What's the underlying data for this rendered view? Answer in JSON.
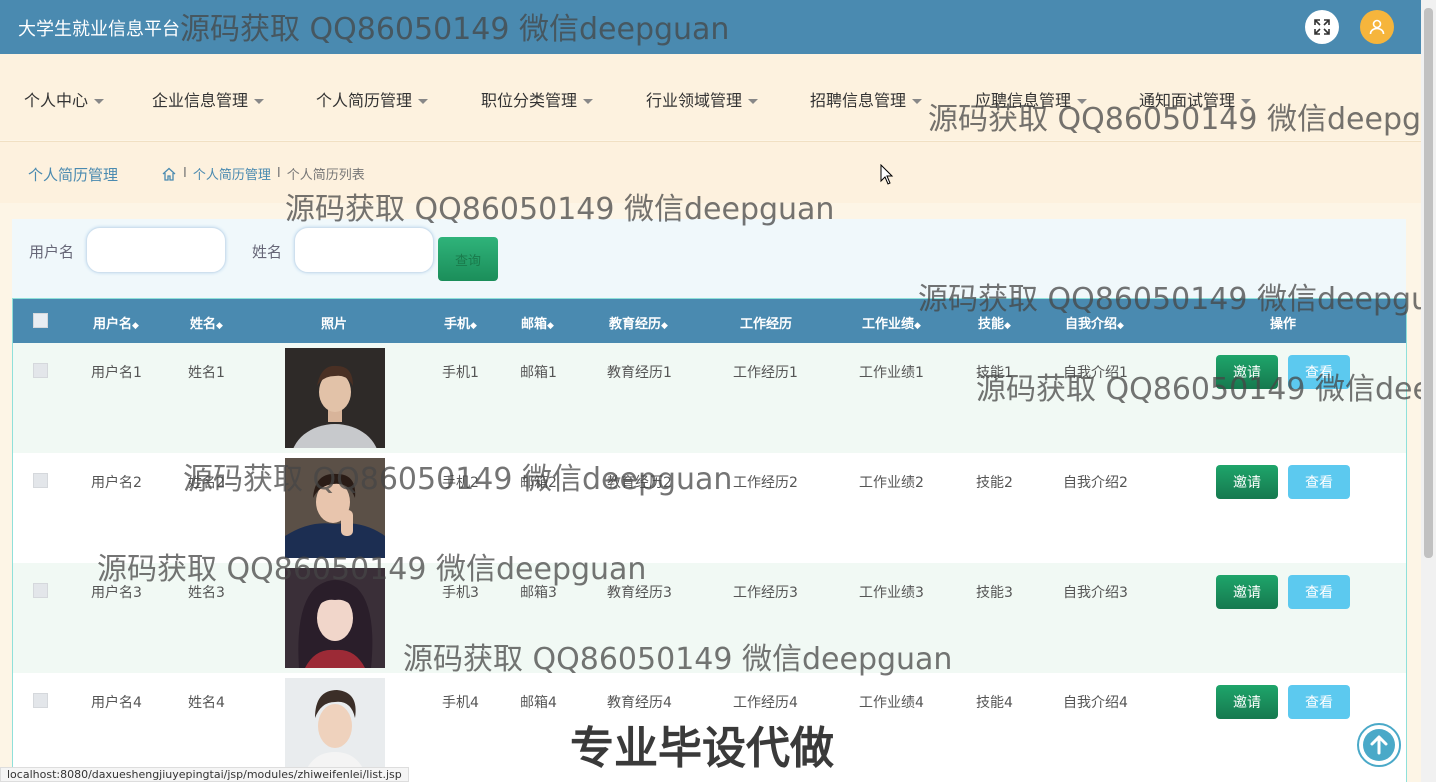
{
  "header": {
    "title": "大学生就业信息平台"
  },
  "menu": [
    {
      "label": "个人中心"
    },
    {
      "label": "企业信息管理"
    },
    {
      "label": "个人简历管理"
    },
    {
      "label": "职位分类管理"
    },
    {
      "label": "行业领域管理"
    },
    {
      "label": "招聘信息管理"
    },
    {
      "label": "应聘信息管理"
    },
    {
      "label": "通知面试管理"
    }
  ],
  "breadcrumb": {
    "title": "个人简历管理",
    "sep": "I",
    "level1": "个人简历管理",
    "level2": "个人简历列表"
  },
  "search": {
    "username_label": "用户名",
    "name_label": "姓名",
    "button": "查询",
    "username_value": "",
    "name_value": ""
  },
  "table": {
    "headers": {
      "username": "用户名",
      "name": "姓名",
      "photo": "照片",
      "phone": "手机",
      "email": "邮箱",
      "education": "教育经历",
      "work": "工作经历",
      "achievement": "工作业绩",
      "skill": "技能",
      "intro": "自我介绍",
      "action": "操作"
    },
    "sort_icon": "◆",
    "rows": [
      {
        "username": "用户名1",
        "name": "姓名1",
        "phone": "手机1",
        "email": "邮箱1",
        "education": "教育经历1",
        "work": "工作经历1",
        "achievement": "工作业绩1",
        "skill": "技能1",
        "intro": "自我介绍1"
      },
      {
        "username": "用户名2",
        "name": "姓名2",
        "phone": "手机2",
        "email": "邮箱2",
        "education": "教育经历2",
        "work": "工作经历2",
        "achievement": "工作业绩2",
        "skill": "技能2",
        "intro": "自我介绍2"
      },
      {
        "username": "用户名3",
        "name": "姓名3",
        "phone": "手机3",
        "email": "邮箱3",
        "education": "教育经历3",
        "work": "工作经历3",
        "achievement": "工作业绩3",
        "skill": "技能3",
        "intro": "自我介绍3"
      },
      {
        "username": "用户名4",
        "name": "姓名4",
        "phone": "手机4",
        "email": "邮箱4",
        "education": "教育经历4",
        "work": "工作经历4",
        "achievement": "工作业绩4",
        "skill": "技能4",
        "intro": "自我介绍4"
      }
    ],
    "invite_label": "邀请",
    "view_label": "查看"
  },
  "watermark": {
    "text": "源码获取 QQ86050149 微信deepguan",
    "big": "专业毕设代做"
  },
  "status_url": "localhost:8080/daxueshengjiuyepingtai/jsp/modules/zhiweifenlei/list.jsp",
  "colors": {
    "header": "#4a8ab0",
    "invite": "#1a8f5c",
    "view": "#5cc9ef",
    "avatar": "#f6b53c"
  }
}
